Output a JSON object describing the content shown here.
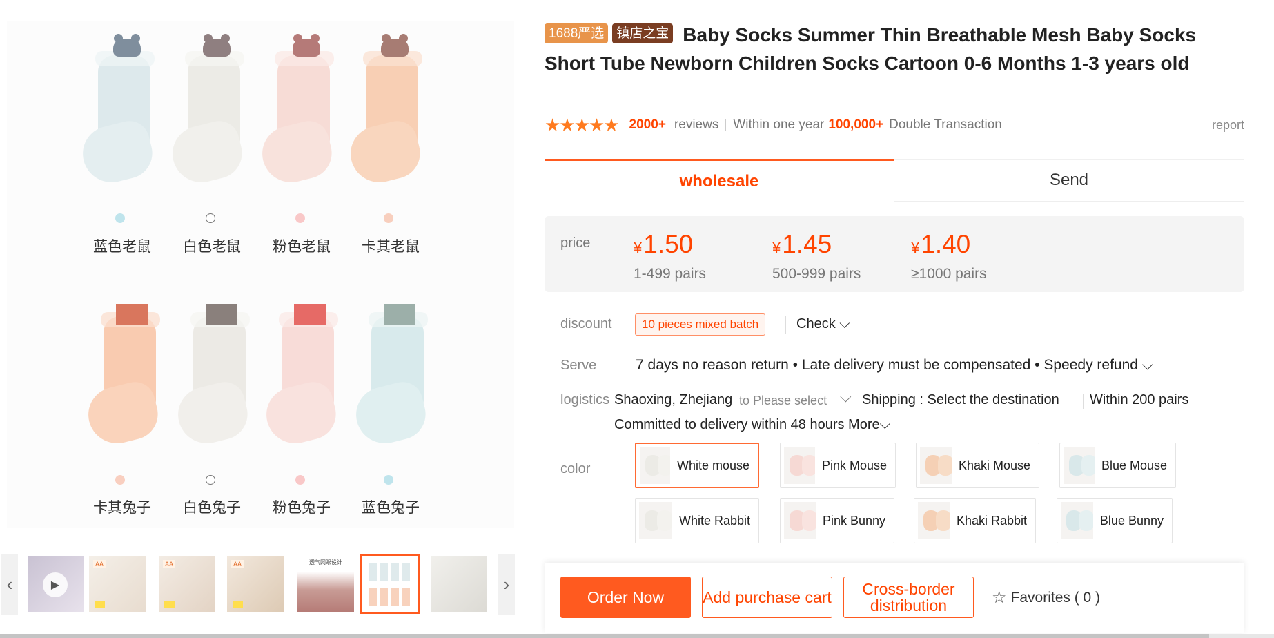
{
  "gallery": {
    "row1_captions": [
      "蓝色老鼠",
      "白色老鼠",
      "粉色老鼠",
      "卡其老鼠"
    ],
    "row2_captions": [
      "卡其兔子",
      "白色兔子",
      "粉色兔子",
      "蓝色兔子"
    ],
    "thumbs": [
      {
        "name": "video",
        "label": ""
      },
      {
        "name": "lifestyle-1",
        "label": "AA"
      },
      {
        "name": "lifestyle-2",
        "label": "AA"
      },
      {
        "name": "lifestyle-3",
        "label": "AA"
      },
      {
        "name": "mesh-detail",
        "label": "透气网眼设计"
      },
      {
        "name": "color-chart",
        "label": ""
      },
      {
        "name": "white-pair",
        "label": ""
      }
    ]
  },
  "product": {
    "badge1": "1688严选",
    "badge2": "镇店之宝",
    "title": "Baby Socks Summer Thin Breathable Mesh Baby Socks Short Tube Newborn Children Socks Cartoon 0-6 Months 1-3 years old"
  },
  "meta": {
    "stars": "★★★★★",
    "reviews_count": "2000+",
    "reviews_label": "reviews",
    "within_label": "Within one year",
    "transactions": "100,000+",
    "transactions_label": "Double Transaction",
    "report": "report"
  },
  "tabs": {
    "wholesale": "wholesale",
    "send": "Send"
  },
  "pricing": {
    "label": "price",
    "currency": "¥",
    "tiers": [
      {
        "price": "1.50",
        "qty": "1-499 pairs"
      },
      {
        "price": "1.45",
        "qty": "500-999 pairs"
      },
      {
        "price": "1.40",
        "qty": "≥1000 pairs"
      }
    ]
  },
  "discount": {
    "label": "discount",
    "tag": "10 pieces mixed batch",
    "check": "Check ⌵"
  },
  "serve": {
    "label": "Serve",
    "text": "7 days no reason return • Late delivery must be compensated • Speedy refund ⌵"
  },
  "logistics": {
    "label": "logistics",
    "origin": "Shaoxing, Zhejiang",
    "to": "to Please select",
    "shipping": "Shipping : Select the destination",
    "within": "Within 200 pairs",
    "commit": "Committed to delivery within 48 hours More⌵"
  },
  "colors": {
    "label": "color",
    "options": [
      "White mouse",
      "Pink Mouse",
      "Khaki Mouse",
      "Blue Mouse",
      "White Rabbit",
      "Pink Bunny",
      "Khaki Rabbit",
      "Blue Bunny"
    ],
    "selected": "White mouse"
  },
  "actions": {
    "order": "Order Now",
    "cart": "Add purchase cart",
    "cross": "Cross-border distribution",
    "favorites": "Favorites ( 0 )"
  },
  "theme": {
    "accent": "#ff5a1f",
    "price": "#ff4400"
  }
}
